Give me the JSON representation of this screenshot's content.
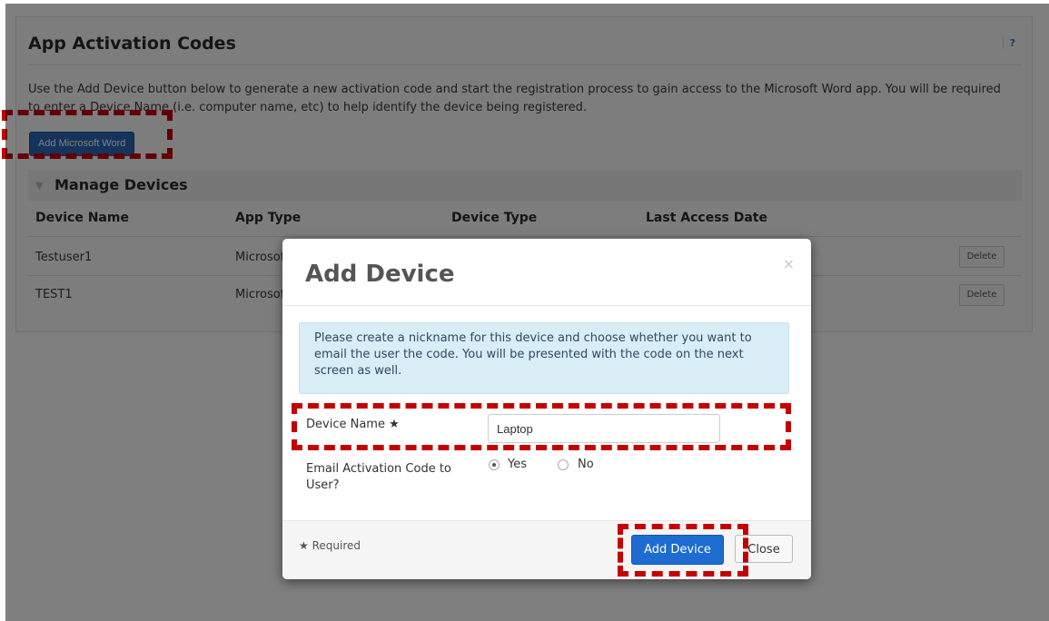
{
  "panel": {
    "title": "App Activation Codes",
    "help": "?",
    "description": "Use the Add Device button below to generate a new activation code and start the registration process to gain access to the Microsoft Word app. You will be required to enter a Device Name (i.e. computer name, etc) to help identify the device being registered.",
    "add_button": "Add Microsoft Word"
  },
  "manage": {
    "title": "Manage Devices",
    "columns": [
      "Device Name",
      "App Type",
      "Device Type",
      "Last Access Date"
    ],
    "rows": [
      {
        "device_name": "Testuser1",
        "app_type": "Microsof",
        "delete": "Delete"
      },
      {
        "device_name": "TEST1",
        "app_type": "Microsof",
        "delete": "Delete"
      }
    ]
  },
  "modal": {
    "title": "Add Device",
    "close_symbol": "×",
    "info": "Please create a nickname for this device and choose whether you want to email the user the code. You will be presented with the code on the next screen as well.",
    "device_name_label": "Device Name",
    "required_star": "★",
    "device_name_value": "Laptop",
    "email_label": "Email Activation Code to User?",
    "radio_yes": "Yes",
    "radio_no": "No",
    "email_selected": "Yes",
    "required_note": "Required",
    "primary_button": "Add Device",
    "close_button": "Close"
  },
  "colors": {
    "primary": "#1e6bd1",
    "info_bg": "#d9edf7",
    "highlight": "#c40000"
  }
}
